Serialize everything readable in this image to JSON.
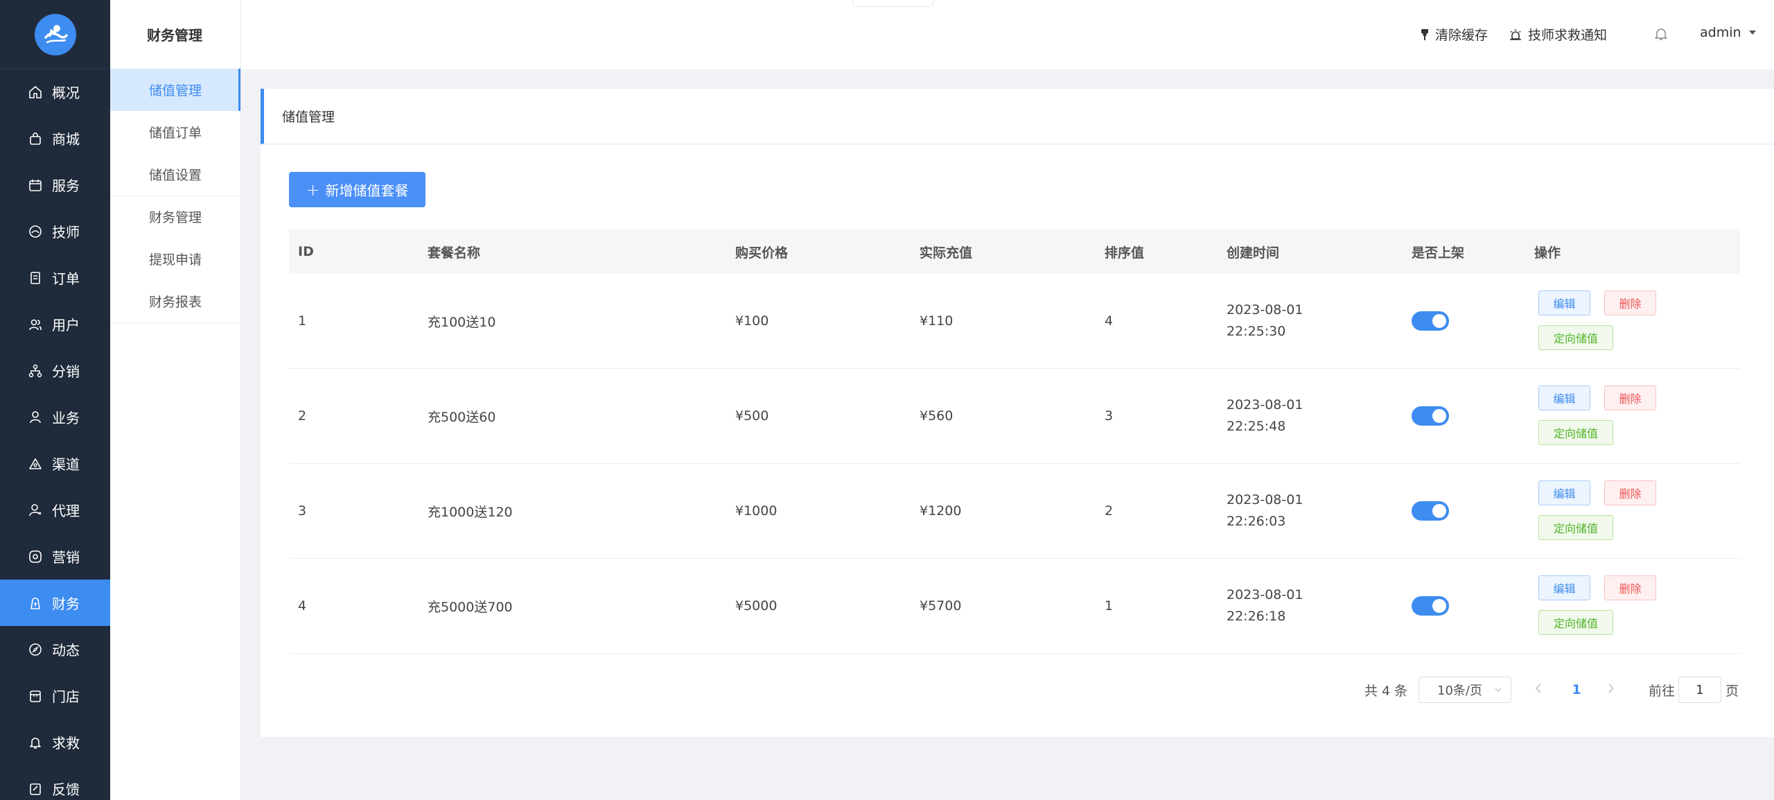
{
  "sidebar": {
    "items": [
      {
        "label": "概况",
        "icon": "home-icon"
      },
      {
        "label": "商城",
        "icon": "shopping-bag-icon"
      },
      {
        "label": "服务",
        "icon": "calendar-icon"
      },
      {
        "label": "技师",
        "icon": "technician-icon"
      },
      {
        "label": "订单",
        "icon": "document-icon"
      },
      {
        "label": "用户",
        "icon": "users-icon"
      },
      {
        "label": "分销",
        "icon": "network-icon"
      },
      {
        "label": "业务",
        "icon": "user-icon"
      },
      {
        "label": "渠道",
        "icon": "triangle-icon"
      },
      {
        "label": "代理",
        "icon": "agent-icon"
      },
      {
        "label": "营销",
        "icon": "marketing-icon"
      },
      {
        "label": "财务",
        "icon": "finance-icon"
      },
      {
        "label": "动态",
        "icon": "compass-icon"
      },
      {
        "label": "门店",
        "icon": "store-icon"
      },
      {
        "label": "求救",
        "icon": "bell-icon"
      },
      {
        "label": "反馈",
        "icon": "feedback-icon"
      }
    ],
    "active": "财务"
  },
  "submenu": {
    "title": "财务管理",
    "items": [
      "储值管理",
      "储值订单",
      "储值设置",
      "财务管理",
      "提现申请",
      "财务报表"
    ],
    "active": "储值管理"
  },
  "header": {
    "clear_cache": "清除缓存",
    "help_notice": "技师求救通知",
    "user": "admin"
  },
  "page": {
    "title": "储值管理",
    "add_button": "新增储值套餐"
  },
  "table": {
    "columns": [
      "ID",
      "套餐名称",
      "购买价格",
      "实际充值",
      "排序值",
      "创建时间",
      "是否上架",
      "操作"
    ],
    "rows": [
      {
        "id": "1",
        "name": "充100送10",
        "price": "¥100",
        "recharge": "¥110",
        "sort": "4",
        "date": "2023-08-01",
        "time": "22:25:30",
        "on_shelf": true
      },
      {
        "id": "2",
        "name": "充500送60",
        "price": "¥500",
        "recharge": "¥560",
        "sort": "3",
        "date": "2023-08-01",
        "time": "22:25:48",
        "on_shelf": true
      },
      {
        "id": "3",
        "name": "充1000送120",
        "price": "¥1000",
        "recharge": "¥1200",
        "sort": "2",
        "date": "2023-08-01",
        "time": "22:26:03",
        "on_shelf": true
      },
      {
        "id": "4",
        "name": "充5000送700",
        "price": "¥5000",
        "recharge": "¥5700",
        "sort": "1",
        "date": "2023-08-01",
        "time": "22:26:18",
        "on_shelf": true
      }
    ],
    "actions": {
      "edit": "编辑",
      "delete": "删除",
      "directed": "定向储值"
    }
  },
  "pagination": {
    "total": "共 4 条",
    "page_size": "10条/页",
    "current_page": "1",
    "goto_prefix": "前往",
    "goto_value": "1",
    "goto_suffix": "页"
  },
  "colors": {
    "sidebar_bg": "#1f2a3a",
    "accent": "#3d8cf0",
    "danger": "#f05656",
    "success": "#52b32a"
  }
}
